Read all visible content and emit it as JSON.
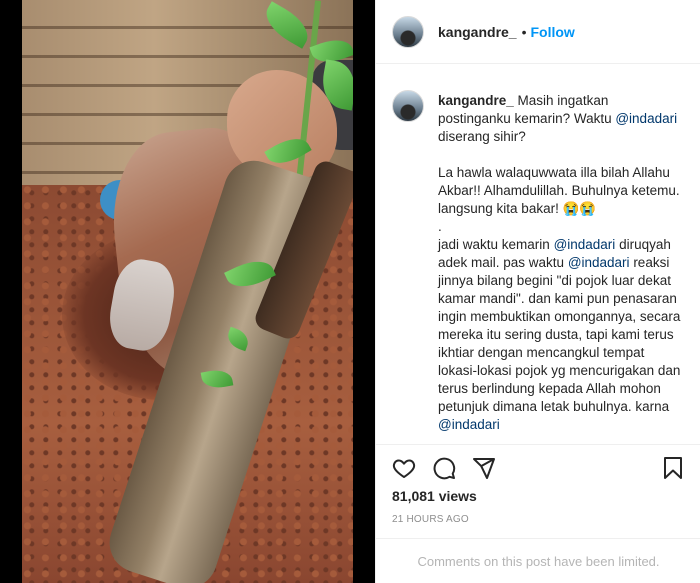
{
  "post": {
    "username": "kangandre_",
    "separator": "•",
    "follow_label": "Follow"
  },
  "caption": {
    "username": "kangandre_",
    "lines": [
      {
        "text": " Masih ingatkan postinganku kemarin? Waktu "
      },
      {
        "mention": "@indadari"
      },
      {
        "text": " diserang sihir?"
      }
    ],
    "para2": "La hawla walaquwwata illa bilah Allahu Akbar!! Alhamdulillah. Buhulnya ketemu. langsung kita bakar! 😭😭",
    "dot": ".",
    "para3_a": "jadi waktu kemarin ",
    "para3_mention1": "@indadari",
    "para3_b": " diruqyah adek mail. pas waktu ",
    "para3_mention2": "@indadari",
    "para3_c": " reaksi jinnya bilang begini \"di pojok luar dekat kamar mandi\". dan kami pun penasaran ingin membuktikan omongannya, secara mereka itu sering dusta, tapi kami terus ikhtiar dengan mencangkul tempat lokasi-lokasi pojok yg mencurigakan dan terus berlindung kepada Allah mohon petunjuk dimana letak buhulnya. karna ",
    "para3_mention3": "@indadari"
  },
  "actions": {
    "icons": [
      "heart-icon",
      "comment-icon",
      "share-icon",
      "bookmark-icon"
    ]
  },
  "stats": {
    "views": "81,081 views",
    "timestamp": "21 HOURS AGO"
  },
  "footer": {
    "limited_text": "Comments on this post have been limited."
  },
  "colors": {
    "follow": "#0095f6",
    "mention": "#00376b",
    "muted": "#8e8e8e",
    "border": "#efefef"
  }
}
